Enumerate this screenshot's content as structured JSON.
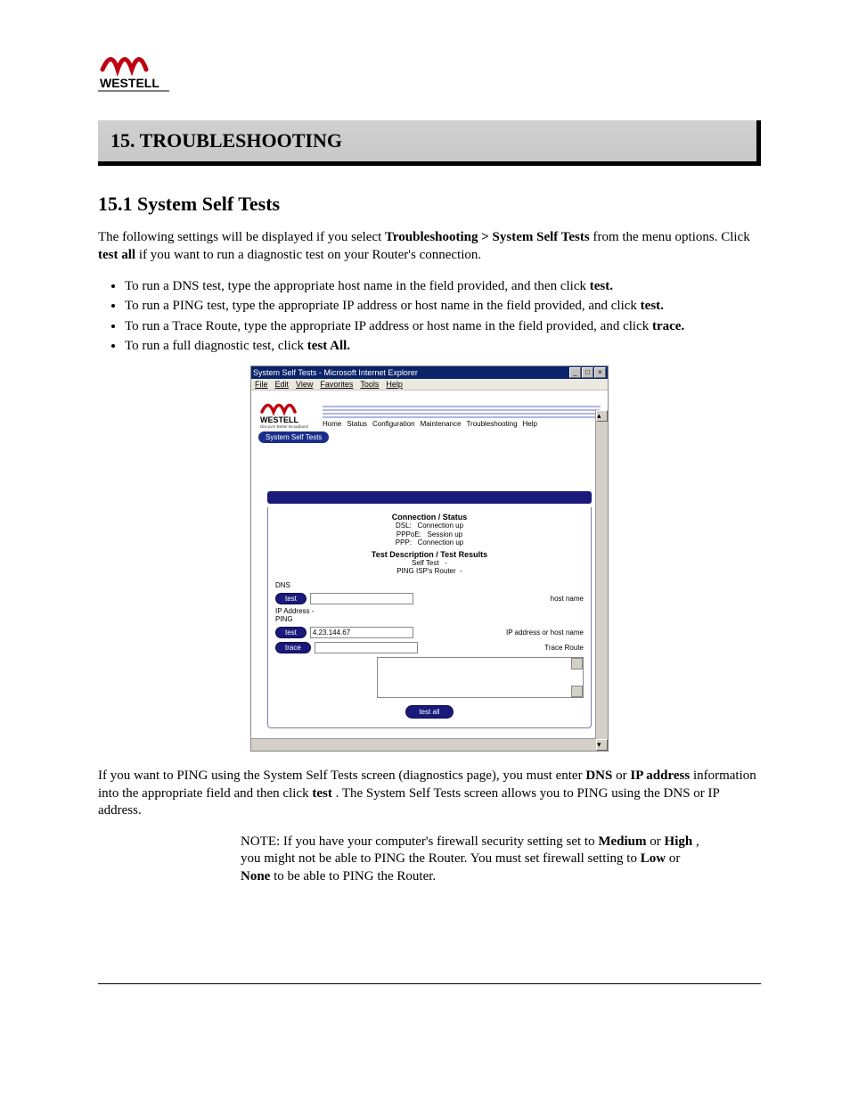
{
  "logo": {
    "name": "WESTELL"
  },
  "banner": {
    "title": "15.  TROUBLESHOOTING"
  },
  "section": {
    "title": "15.1 System Self Tests"
  },
  "intro": {
    "line1_prefix": "The following settings will be displayed if you select ",
    "line1_bold": "Troubleshooting > System Self Tests",
    "line1_suffix": " from the menu options. Click ",
    "line1_bold2": "test all",
    "line1_end": " if you want to run a diagnostic test on your Router's connection."
  },
  "bullets": {
    "b1_a": "To run a DNS test, type the appropriate host name in the field provided, and then click ",
    "b1_b": "test.",
    "b2_a": "To run a PING test, type the appropriate IP address or host name in the field provided, and click ",
    "b2_b": "test.",
    "b3_a": "To run a Trace Route, type the appropriate IP address or host name in the field provided, and click ",
    "b3_b": "trace.",
    "b4_a": "To run a full diagnostic test, click ",
    "b4_b": "test All."
  },
  "inset": {
    "title": "System Self Tests - Microsoft Internet Explorer",
    "menus": {
      "file": "File",
      "edit": "Edit",
      "view": "View",
      "fav": "Favorites",
      "tools": "Tools",
      "help": "Help"
    },
    "tagline": "Discover Better Broadband",
    "nav": {
      "home": "Home",
      "status": "Status",
      "config": "Configuration",
      "maint": "Maintenance",
      "trouble": "Troubleshooting",
      "help": "Help"
    },
    "tab": "System Self Tests",
    "conn_hd": "Connection / Status",
    "dsl_k": "DSL:",
    "dsl_v": "Connection up",
    "pppoe_k": "PPPoE:",
    "pppoe_v": "Session up",
    "ppp_k": "PPP:",
    "ppp_v": "Connection up",
    "desc_hd": "Test Description / Test Results",
    "self_k": "Self Test",
    "self_v": "-",
    "pingisp_k": "PING ISP's Router",
    "pingisp_v": "-",
    "dns_lbl": "DNS",
    "test_btn": "test",
    "hostname": "host name",
    "ipaddr_lbl": "IP Address -",
    "ping_lbl": "PING",
    "ping_val": "4.23.144.67",
    "ping_hint": "IP address or host name",
    "trace_btn": "trace",
    "trace_hint": "Trace Route",
    "testall_btn": "test all"
  },
  "note1": {
    "a": "If you want to PING using the System Self Tests screen (diagnostics page), you must enter ",
    "b": "DNS",
    "c": " or ",
    "d": "IP address",
    "e": " information into the appropriate field and then click ",
    "f": "test",
    "g": ". The System Self Tests screen allows you to PING using the DNS or IP address."
  },
  "note2": {
    "a": "NOTE: If you have your computer's firewall security setting set to ",
    "b": "Medium",
    "c": " or ",
    "d": "High",
    "e": ", you might not be able to PING the Router. You must set firewall setting to ",
    "f": "Low",
    "g": " or ",
    "h": "None",
    "i": " to be able to PING the Router."
  }
}
